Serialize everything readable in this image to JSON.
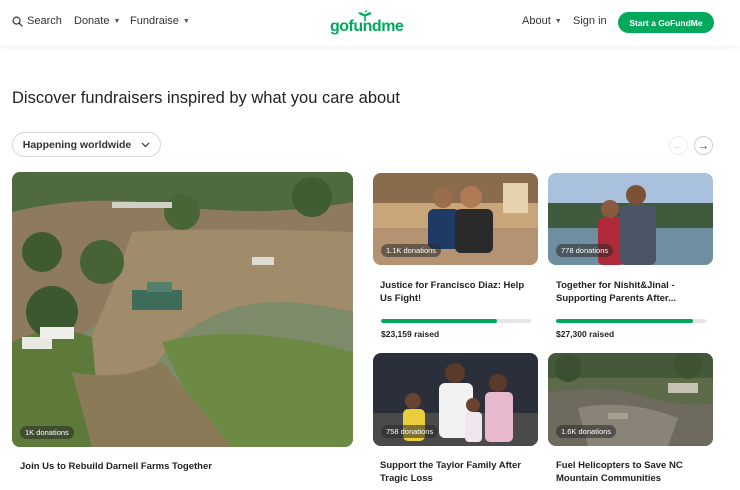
{
  "header": {
    "search_label": "Search",
    "donate_label": "Donate",
    "fundraise_label": "Fundraise",
    "logo_text": "gofundme",
    "about_label": "About",
    "signin_label": "Sign in",
    "start_label": "Start a GoFundMe"
  },
  "headline": "Discover fundraisers inspired by what you care about",
  "filter": {
    "label": "Happening worldwide"
  },
  "colors": {
    "brand": "#02a95c",
    "progress_track": "#e6e6e6"
  },
  "featured": {
    "badge": "1K donations",
    "title": "Join Us to Rebuild Darnell Farms Together"
  },
  "cards": [
    {
      "badge": "1.1K donations",
      "title_line1": "Justice for Francisco Diaz: Help",
      "title_line2": "Us Fight!",
      "raised": "$23,159 raised",
      "progress": 0.77
    },
    {
      "badge": "778 donations",
      "title_line1": "Together for Nishit&Jinal -",
      "title_line2": "Supporting Parents After...",
      "raised": "$27,300 raised",
      "progress": 0.91
    },
    {
      "badge": "758 donations",
      "title_line1": "Support the Taylor Family After",
      "title_line2": "Tragic Loss"
    },
    {
      "badge": "1.6K donations",
      "title_line1": "Fuel Helicopters to Save NC",
      "title_line2": "Mountain Communities"
    }
  ]
}
